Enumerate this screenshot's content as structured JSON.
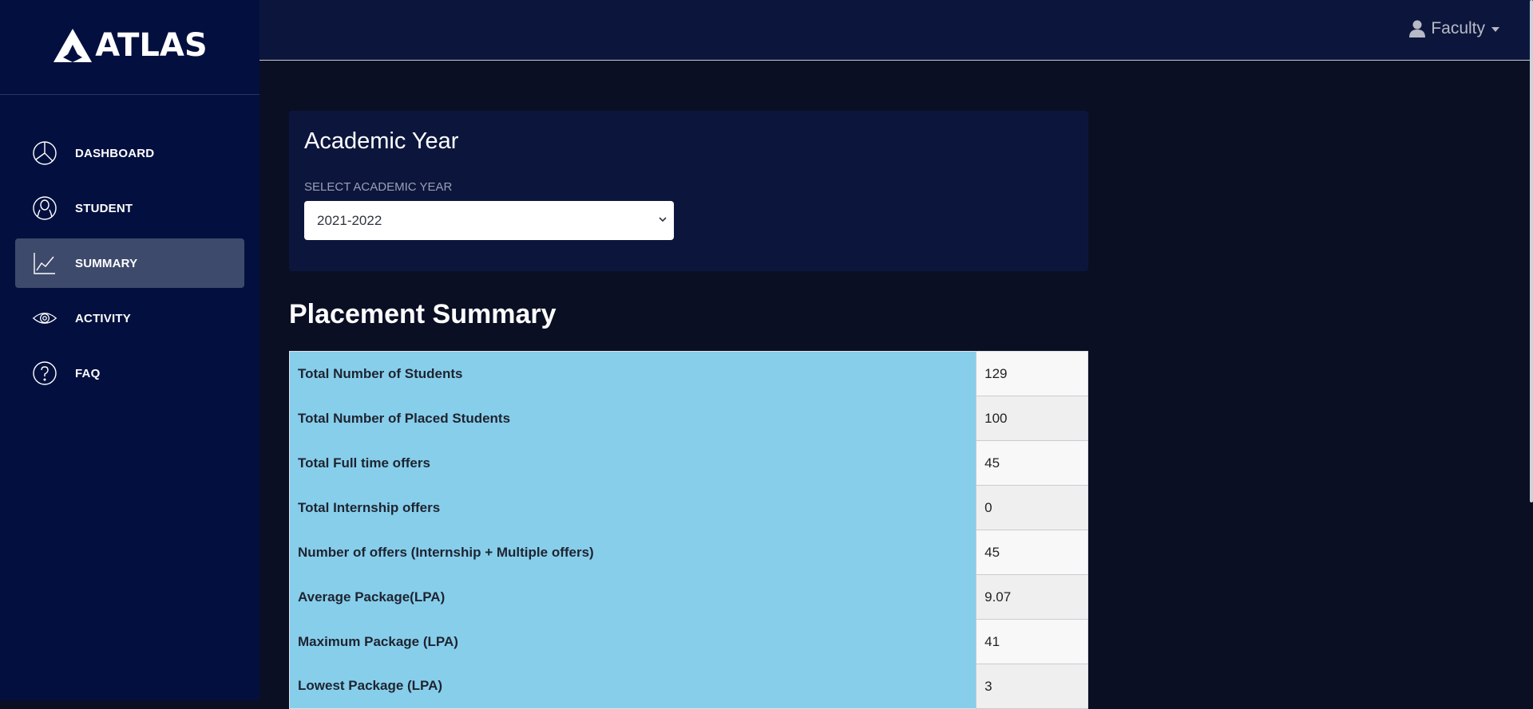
{
  "brand": {
    "name": "ATLAS"
  },
  "sidebar": {
    "items": [
      {
        "label": "DASHBOARD",
        "icon": "pie-chart-icon",
        "active": false
      },
      {
        "label": "STUDENT",
        "icon": "user-circle-icon",
        "active": false
      },
      {
        "label": "SUMMARY",
        "icon": "line-chart-icon",
        "active": true
      },
      {
        "label": "ACTIVITY",
        "icon": "eye-icon",
        "active": false
      },
      {
        "label": "FAQ",
        "icon": "question-circle-icon",
        "active": false
      }
    ]
  },
  "header": {
    "user_label": "Faculty",
    "user_icon": "user-icon"
  },
  "year_card": {
    "title": "Academic Year",
    "field_label": "SELECT ACADEMIC YEAR",
    "selected_year": "2021-2022"
  },
  "summary": {
    "title": "Placement Summary",
    "rows": [
      {
        "label": "Total Number of Students",
        "value": "129"
      },
      {
        "label": "Total Number of Placed Students",
        "value": "100"
      },
      {
        "label": "Total Full time offers",
        "value": "45"
      },
      {
        "label": "Total Internship offers",
        "value": "0"
      },
      {
        "label": "Number of offers (Internship + Multiple offers)",
        "value": "45"
      },
      {
        "label": "Average Package(LPA)",
        "value": "9.07"
      },
      {
        "label": "Maximum Package (LPA)",
        "value": "41"
      },
      {
        "label": "Lowest Package (LPA)",
        "value": "3"
      }
    ]
  },
  "colors": {
    "sidebar_bg": "#03103f",
    "page_bg": "#0a0f24",
    "card_bg": "#0c163d",
    "active_item_bg": "#3d4a6b",
    "table_label_bg": "#87ceeb"
  }
}
